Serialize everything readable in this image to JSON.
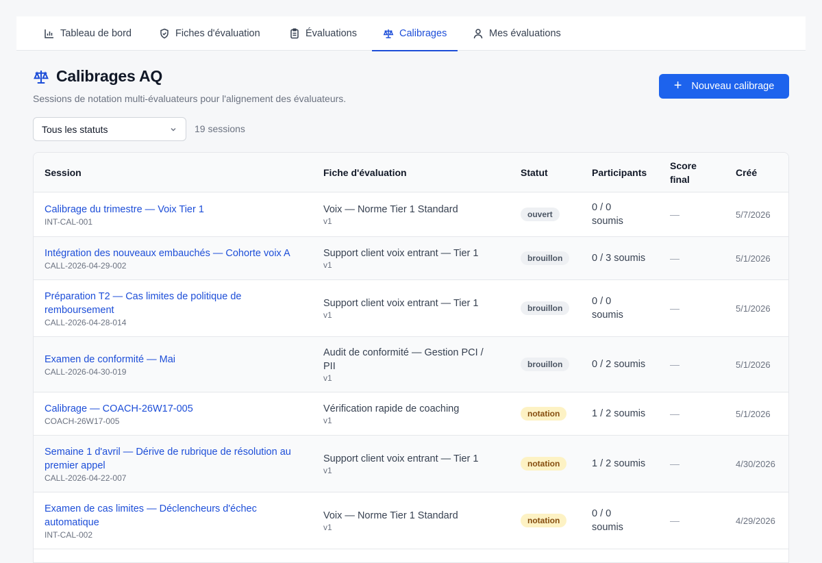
{
  "nav": {
    "tabs": [
      {
        "label": "Tableau de bord",
        "icon": "bar-chart-icon"
      },
      {
        "label": "Fiches d'évaluation",
        "icon": "shield-icon"
      },
      {
        "label": "Évaluations",
        "icon": "clipboard-icon"
      },
      {
        "label": "Calibrages",
        "icon": "scale-icon",
        "active": true
      },
      {
        "label": "Mes évaluations",
        "icon": "user-icon"
      }
    ]
  },
  "header": {
    "title": "Calibrages AQ",
    "subtitle": "Sessions de notation multi-évaluateurs pour l'alignement des évaluateurs.",
    "new_button": "Nouveau calibrage"
  },
  "filter": {
    "status_value": "Tous les statuts",
    "count": "19 sessions"
  },
  "table": {
    "headers": {
      "session": "Session",
      "form": "Fiche d'évaluation",
      "status": "Statut",
      "participants": "Participants",
      "score_line1": "Score",
      "score_line2": "final",
      "created": "Créé"
    },
    "rows": [
      {
        "title": "Calibrage du trimestre — Voix Tier 1",
        "id": "INT-CAL-001",
        "form": "Voix — Norme Tier 1 Standard",
        "version": "v1",
        "status": "ouvert",
        "participants": "0 / 0 soumis",
        "score": "—",
        "created": "5/7/2026"
      },
      {
        "title": "Intégration des nouveaux embauchés — Cohorte voix A",
        "id": "CALL-2026-04-29-002",
        "form": "Support client voix entrant — Tier 1",
        "version": "v1",
        "status": "brouillon",
        "participants": "0 / 3 soumis",
        "score": "—",
        "created": "5/1/2026"
      },
      {
        "title": "Préparation T2 — Cas limites de politique de remboursement",
        "id": "CALL-2026-04-28-014",
        "form": "Support client voix entrant — Tier 1",
        "version": "v1",
        "status": "brouillon",
        "participants": "0 / 0 soumis",
        "score": "—",
        "created": "5/1/2026"
      },
      {
        "title": "Examen de conformité — Mai",
        "id": "CALL-2026-04-30-019",
        "form": "Audit de conformité — Gestion PCI / PII",
        "version": "v1",
        "status": "brouillon",
        "participants": "0 / 2 soumis",
        "score": "—",
        "created": "5/1/2026"
      },
      {
        "title": "Calibrage — COACH-26W17-005",
        "id": "COACH-26W17-005",
        "form": "Vérification rapide de coaching",
        "version": "v1",
        "status": "notation",
        "participants": "1 / 2 soumis",
        "score": "—",
        "created": "5/1/2026"
      },
      {
        "title": "Semaine 1 d'avril — Dérive de rubrique de résolution au premier appel",
        "id": "CALL-2026-04-22-007",
        "form": "Support client voix entrant — Tier 1",
        "version": "v1",
        "status": "notation",
        "participants": "1 / 2 soumis",
        "score": "—",
        "created": "4/30/2026"
      },
      {
        "title": "Examen de cas limites — Déclencheurs d'échec automatique",
        "id": "INT-CAL-002",
        "form": "Voix — Norme Tier 1 Standard",
        "version": "v1",
        "status": "notation",
        "participants": "0 / 0 soumis",
        "score": "—",
        "created": "4/29/2026"
      }
    ]
  },
  "colors": {
    "accent": "#1d4ed8",
    "button": "#1d63ed",
    "badge_notation": "#fdf2c4"
  }
}
